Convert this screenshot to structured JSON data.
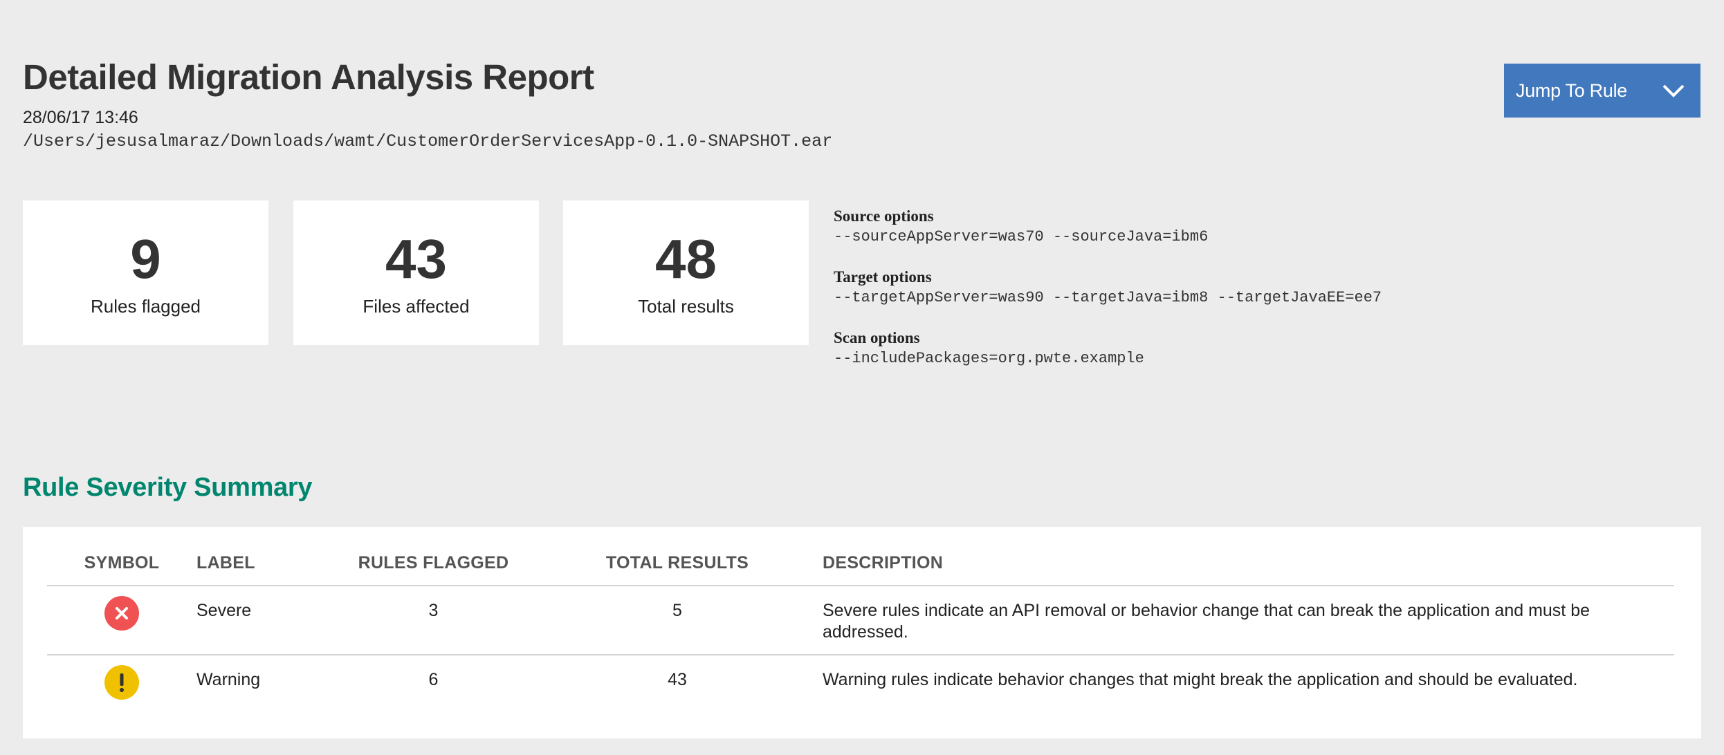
{
  "header": {
    "title": "Detailed Migration Analysis Report",
    "date": "28/06/17 13:46",
    "path": "/Users/jesusalmaraz/Downloads/wamt/CustomerOrderServicesApp-0.1.0-SNAPSHOT.ear"
  },
  "jump_button": {
    "label": "Jump To Rule",
    "icon": "chevron-down-icon",
    "color": "#4178be"
  },
  "stats": [
    {
      "value": "9",
      "label": "Rules flagged"
    },
    {
      "value": "43",
      "label": "Files affected"
    },
    {
      "value": "48",
      "label": "Total results"
    }
  ],
  "options": [
    {
      "title": "Source options",
      "value": "--sourceAppServer=was70 --sourceJava=ibm6"
    },
    {
      "title": "Target options",
      "value": "--targetAppServer=was90 --targetJava=ibm8 --targetJavaEE=ee7"
    },
    {
      "title": "Scan options",
      "value": "--includePackages=org.pwte.example"
    }
  ],
  "severity_summary": {
    "title": "Rule Severity Summary",
    "title_color": "#00856e",
    "columns": [
      "SYMBOL",
      "LABEL",
      "RULES FLAGGED",
      "TOTAL RESULTS",
      "DESCRIPTION"
    ],
    "rows": [
      {
        "symbol": "severe-x-icon",
        "symbol_color": "#f05153",
        "label": "Severe",
        "rules_flagged": "3",
        "total_results": "5",
        "description": "Severe rules indicate an API removal or behavior change that can break the application and must be addressed."
      },
      {
        "symbol": "warning-exclamation-icon",
        "symbol_color": "#efc100",
        "label": "Warning",
        "rules_flagged": "6",
        "total_results": "43",
        "description": "Warning rules indicate behavior changes that might break the application and should be evaluated."
      }
    ]
  }
}
